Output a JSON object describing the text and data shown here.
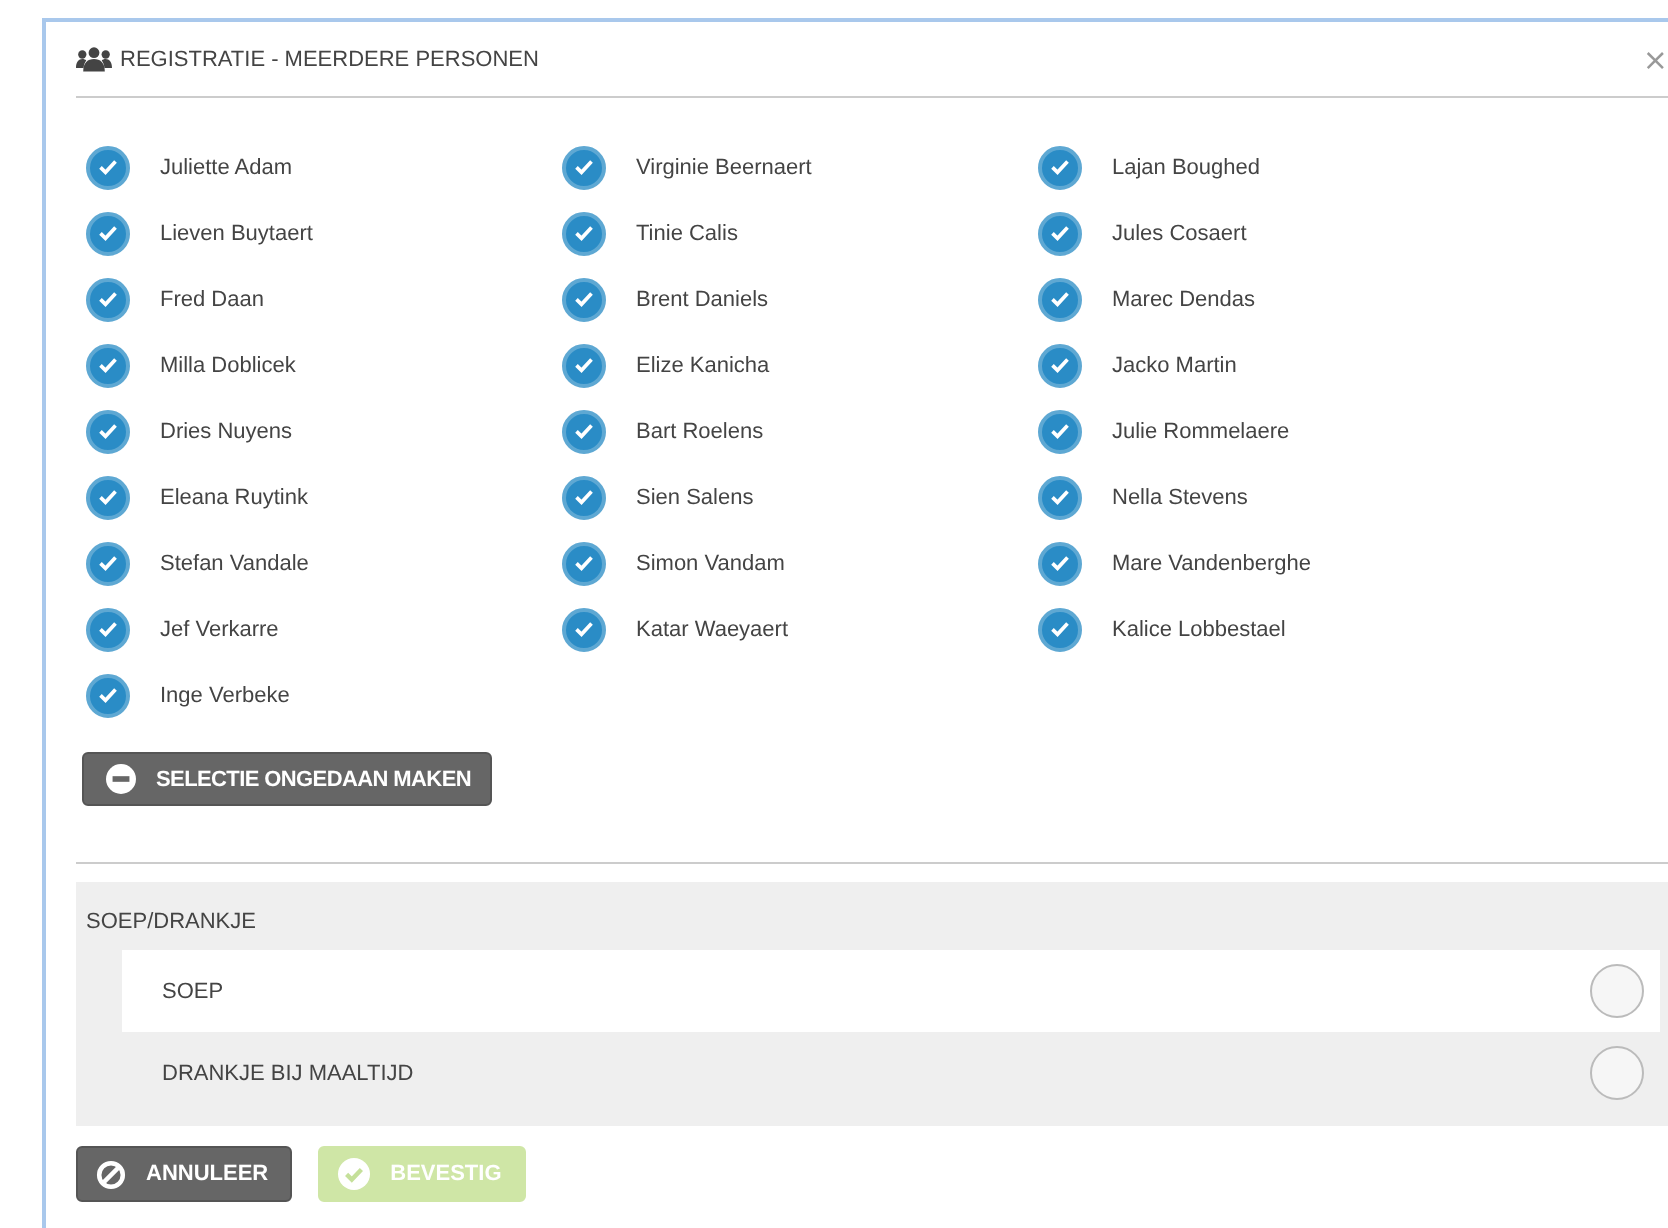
{
  "window": {
    "title": "REGISTRATIE - MEERDERE PERSONEN",
    "close": "×"
  },
  "persons": [
    {
      "name": "Juliette Adam",
      "checked": true
    },
    {
      "name": "Virginie Beernaert",
      "checked": true
    },
    {
      "name": "Lajan Boughed",
      "checked": true
    },
    {
      "name": "Lieven Buytaert",
      "checked": true
    },
    {
      "name": "Tinie Calis",
      "checked": true
    },
    {
      "name": "Jules Cosaert",
      "checked": true
    },
    {
      "name": "Fred Daan",
      "checked": true
    },
    {
      "name": "Brent Daniels",
      "checked": true
    },
    {
      "name": "Marec Dendas",
      "checked": true
    },
    {
      "name": "Milla Doblicek",
      "checked": true
    },
    {
      "name": "Elize Kanicha",
      "checked": true
    },
    {
      "name": "Jacko Martin",
      "checked": true
    },
    {
      "name": "Dries Nuyens",
      "checked": true
    },
    {
      "name": "Bart Roelens",
      "checked": true
    },
    {
      "name": "Julie Rommelaere",
      "checked": true
    },
    {
      "name": "Eleana Ruytink",
      "checked": true
    },
    {
      "name": "Sien Salens",
      "checked": true
    },
    {
      "name": "Nella Stevens",
      "checked": true
    },
    {
      "name": "Stefan Vandale",
      "checked": true
    },
    {
      "name": "Simon Vandam",
      "checked": true
    },
    {
      "name": "Mare Vandenberghe",
      "checked": true
    },
    {
      "name": "Jef Verkarre",
      "checked": true
    },
    {
      "name": "Katar Waeyaert",
      "checked": true
    },
    {
      "name": "Kalice Lobbestael",
      "checked": true
    },
    {
      "name": "Inge Verbeke",
      "checked": true
    }
  ],
  "deselect_button": "SELECTIE ONGEDAAN MAKEN",
  "options_group": {
    "title": "SOEP/DRANKJE",
    "options": [
      {
        "label": "SOEP",
        "selected": false
      },
      {
        "label": "DRANKJE BIJ MAALTIJD",
        "selected": false
      }
    ]
  },
  "buttons": [
    {
      "kind": "cancel",
      "label": "ANNULEER",
      "disabled": false
    },
    {
      "kind": "confirm",
      "label": "BEVESTIG",
      "disabled": true
    }
  ]
}
